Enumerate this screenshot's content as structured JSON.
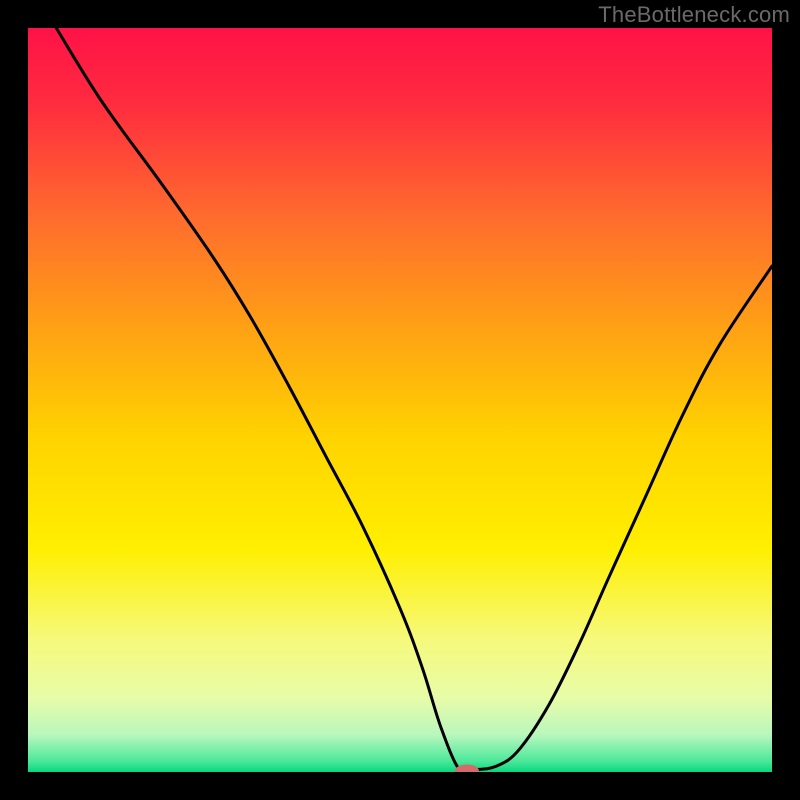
{
  "watermark": "TheBottleneck.com",
  "chart_data": {
    "type": "line",
    "title": "",
    "xlabel": "",
    "ylabel": "",
    "xlim": [
      0,
      100
    ],
    "ylim": [
      0,
      100
    ],
    "grid": false,
    "legend": false,
    "gradient_stops": [
      {
        "offset": 0.0,
        "color": "#ff1247"
      },
      {
        "offset": 0.1,
        "color": "#ff2b3f"
      },
      {
        "offset": 0.25,
        "color": "#ff6a2e"
      },
      {
        "offset": 0.4,
        "color": "#ffa015"
      },
      {
        "offset": 0.55,
        "color": "#ffd300"
      },
      {
        "offset": 0.7,
        "color": "#ffef00"
      },
      {
        "offset": 0.82,
        "color": "#f6f97a"
      },
      {
        "offset": 0.9,
        "color": "#e8fca8"
      },
      {
        "offset": 0.95,
        "color": "#b9f7bd"
      },
      {
        "offset": 0.985,
        "color": "#4de89b"
      },
      {
        "offset": 1.0,
        "color": "#07d77f"
      }
    ],
    "series": [
      {
        "name": "bottleneck-curve",
        "x": [
          3.8,
          10,
          18,
          25,
          30,
          35,
          40,
          45,
          50,
          53,
          55.5,
          58,
          60,
          63,
          66,
          70,
          74,
          78,
          83,
          88,
          93,
          100
        ],
        "y": [
          100,
          90,
          79,
          69,
          61,
          52,
          42.5,
          33,
          22,
          14,
          6,
          0.3,
          0.3,
          0.8,
          3,
          9,
          17,
          26,
          37,
          48,
          57.5,
          68
        ]
      }
    ],
    "marker": {
      "x": 59,
      "y": 0.2,
      "rx": 1.6,
      "ry": 0.8,
      "color": "#d56a6a"
    }
  }
}
